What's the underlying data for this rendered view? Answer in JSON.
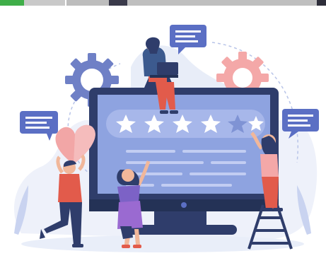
{
  "illustration": {
    "subject": "customer-feedback-rating",
    "rating": {
      "filled_stars": 4,
      "total_stars": 5
    },
    "colors": {
      "accent_green": "#3fae49",
      "monitor_frame": "#2f3d6b",
      "screen": "#8ea3e0",
      "star": "#ffffff",
      "empty_star": "#7f93d4",
      "gear_blue": "#6f80c6",
      "gear_pink": "#f4a8a8",
      "heart": "#f2a6a6",
      "bubble": "#5b6fc4",
      "background_blob": "#e8edf8"
    },
    "icons": [
      "gear-icon",
      "speech-bubble-icon",
      "star-icon",
      "heart-icon",
      "laptop-icon",
      "ladder-icon"
    ]
  }
}
